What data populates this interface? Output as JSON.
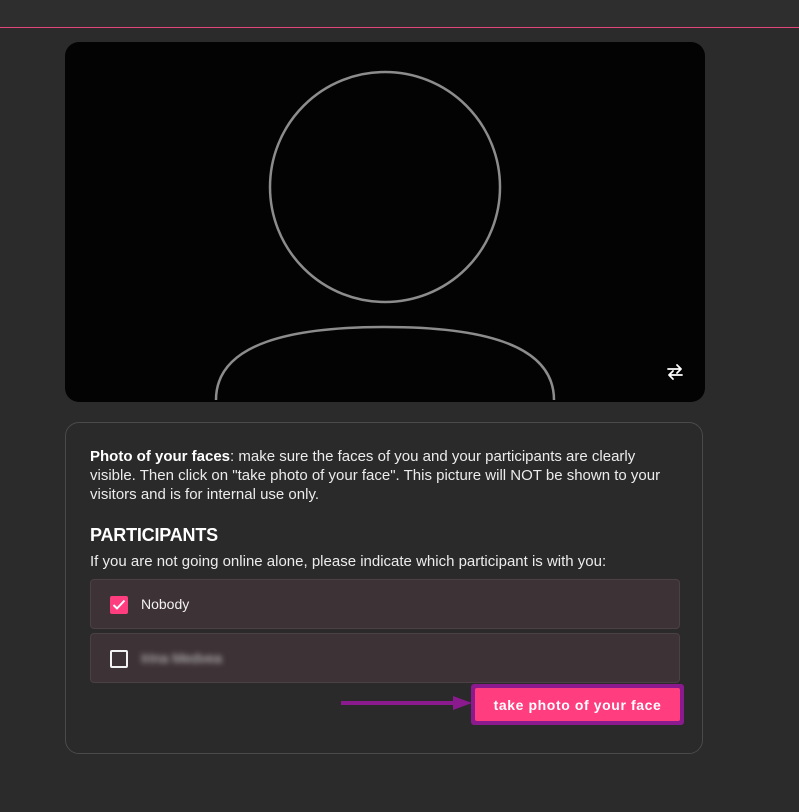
{
  "camera": {
    "flip_icon": "swap-horizontal-icon"
  },
  "panel": {
    "intro_bold": "Photo of your faces",
    "intro_rest": ": make sure the faces of you and your participants are clearly visible. Then click on \"take photo of your face\". This picture will NOT be shown to your visitors and is for internal use only.",
    "participants_title": "PARTICIPANTS",
    "participants_subtitle": "If you are not going online alone, please indicate which participant is with you:",
    "options": [
      {
        "label": "Nobody",
        "checked": true
      },
      {
        "label": "Irina Medvea",
        "checked": false
      }
    ],
    "take_photo_label": "take photo of your face"
  },
  "colors": {
    "accent": "#ff3d7f",
    "highlight_border": "#8a1a8e",
    "background": "#2b2b2b",
    "option_bg": "#3d3236"
  }
}
